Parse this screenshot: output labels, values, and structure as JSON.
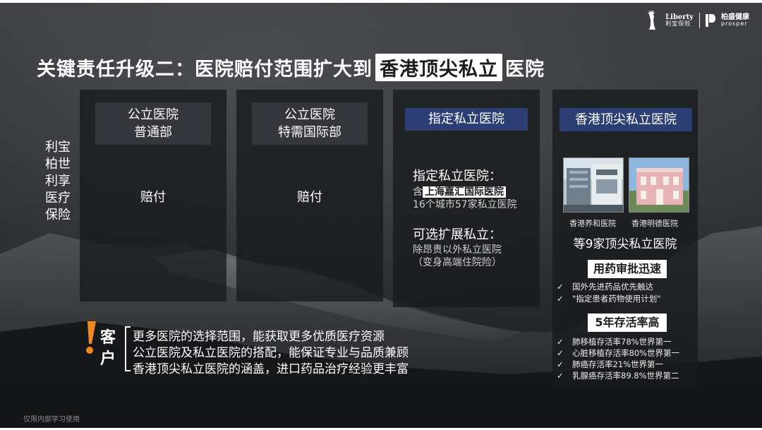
{
  "header": {
    "logo_liberty": "Liberty",
    "logo_liberty_sub": "利宝保险",
    "logo_prosper": "柏盛健康",
    "logo_prosper_sub": "prosper"
  },
  "title": {
    "prefix": "关键责任升级二：医院赔付范围扩大到",
    "highlight": "香港顶尖私立",
    "suffix": "医院"
  },
  "side_label": {
    "lines": [
      "利宝",
      "柏世",
      "利享",
      "医疗",
      "保险"
    ]
  },
  "columns": [
    {
      "header_lines": [
        "公立医院",
        "普通部"
      ],
      "body": "赔付"
    },
    {
      "header_lines": [
        "公立医院",
        "特需国际部"
      ],
      "body": "赔付"
    },
    {
      "header": "指定私立医院",
      "section1_title": "指定私立医院：",
      "section1_prefix": "含",
      "section1_highlight": "上海嘉汇国际医院",
      "section1_line2": "16个城市57家私立医院",
      "section2_title": "可选扩展私立：",
      "section2_line1": "除昂贵以外私立医院",
      "section2_line2": "（变身高端住院险）"
    },
    {
      "header": "香港顶尖私立医院",
      "photo_captions": [
        "香港养和医院",
        "香港明德医院"
      ],
      "count_text": "等9家顶尖私立医院",
      "tag1": "用药审批迅速",
      "tag1_items": [
        "国外先进药品优先触达",
        "\"指定患者药物使用计划\""
      ],
      "tag2": "5年存活率高",
      "tag2_items": [
        "肺移植存活率78%世界第一",
        "心脏移植存活率80%世界第一",
        "肺癌存活率21%世界第一",
        "乳腺癌存活率89.8%世界第二"
      ],
      "check_mark": "✓"
    }
  ],
  "customer_note": {
    "exclamation": "!",
    "label": "客户",
    "lines": [
      "更多医院的选择范围，能获取更多优质医疗资源",
      "公立医院及私立医院的搭配，能保证专业与品质兼顾",
      "香港顶尖私立医院的涵盖，进口药品治疗经验更丰富"
    ]
  },
  "footer": {
    "note": "仅限内部学习使用"
  },
  "colors": {
    "accent_orange": "#f08a1c",
    "header_blue": "#2c3f74",
    "panel": "#18191c"
  }
}
